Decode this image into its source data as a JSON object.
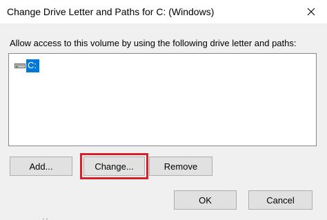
{
  "window": {
    "title": "Change Drive Letter and Paths for C: (Windows)"
  },
  "dialog": {
    "instruction": "Allow access to this volume by using the following drive letter and paths:",
    "list_items": [
      {
        "label": "C:",
        "icon": "drive-icon",
        "selected": true
      }
    ]
  },
  "buttons": {
    "add": "Add...",
    "change": "Change...",
    "remove": "Remove",
    "ok": "OK",
    "cancel": "Cancel"
  },
  "colors": {
    "selection": "#0078d7",
    "highlight": "#d7202a",
    "background": "#f0f0f0"
  }
}
